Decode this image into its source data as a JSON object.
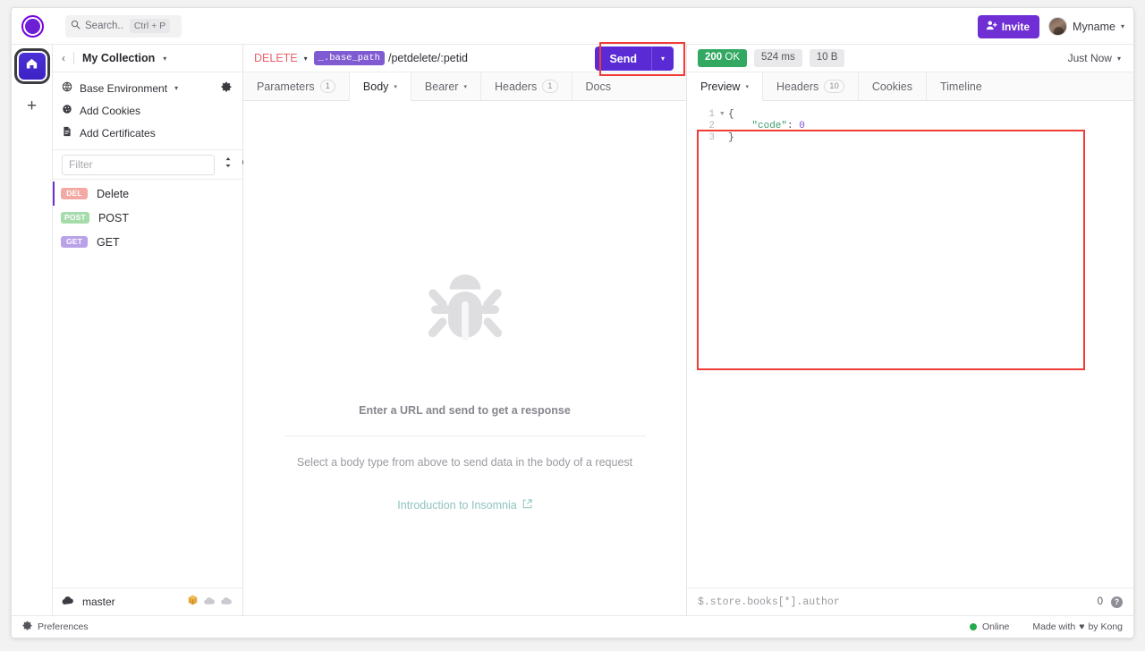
{
  "app": {
    "logo_icon": "insomnia-logo-icon"
  },
  "topbar": {
    "search": {
      "icon": "search-icon",
      "placeholder": "Search..",
      "label": "Search..",
      "shortcut": "Ctrl + P"
    },
    "invite_label": "Invite",
    "invite_icon": "person-add-icon",
    "account_name": "Myname",
    "account_caret": "▾",
    "invite_color": "#6f2fd4"
  },
  "rail": {
    "home_icon": "home-icon",
    "add_icon": "plus-icon",
    "home_color": "#3d21c4"
  },
  "sidebar": {
    "back_icon": "chevron-left-icon",
    "collection_name": "My Collection",
    "collection_caret": "▾",
    "env_items": [
      {
        "icon": "globe-icon",
        "label": "Base Environment",
        "caret": "▾",
        "has_gear": true,
        "gear_icon": "gear-icon"
      },
      {
        "icon": "cookie-icon",
        "label": "Add Cookies",
        "caret": "",
        "has_gear": false
      },
      {
        "icon": "certificate-icon",
        "label": "Add Certificates",
        "caret": "",
        "has_gear": false
      }
    ],
    "filter": {
      "placeholder": "Filter",
      "value": "",
      "sort_icon": "sort-icon",
      "add_icon": "plus-circle-icon"
    },
    "requests": [
      {
        "method": "DEL",
        "method_class": "del",
        "name": "Delete",
        "active": true
      },
      {
        "method": "POST",
        "method_class": "post",
        "name": "POST",
        "active": false
      },
      {
        "method": "GET",
        "method_class": "get",
        "name": "GET",
        "active": false
      }
    ],
    "vcs": {
      "icon": "cloud-icon",
      "branch": "master",
      "icons": [
        "package-icon",
        "cloud-download-icon",
        "cloud-upload-icon"
      ]
    }
  },
  "request": {
    "method": "DELETE",
    "method_caret": "▾",
    "url_template_var": "_.base_path",
    "url_path": "/petdelete/:petid",
    "send_label": "Send",
    "send_caret": "▾",
    "send_color": "#5a2bd4",
    "tabs": [
      {
        "label": "Parameters",
        "count": "1",
        "caret": "",
        "active": false
      },
      {
        "label": "Body",
        "count": "",
        "caret": "▾",
        "active": true
      },
      {
        "label": "Bearer",
        "count": "",
        "caret": "▾",
        "active": false
      },
      {
        "label": "Headers",
        "count": "1",
        "caret": "",
        "active": false
      },
      {
        "label": "Docs",
        "count": "",
        "caret": "",
        "active": false
      }
    ],
    "empty": {
      "illustration_icon": "bug-icon",
      "title": "Enter a URL and send to get a response",
      "subtitle": "Select a body type from above to send data in the body of a request",
      "link_label": "Introduction to Insomnia",
      "link_icon": "external-link-icon"
    }
  },
  "response": {
    "status_code": "200",
    "status_text": "OK",
    "status_color": "#32a862",
    "time": "524 ms",
    "size": "10 B",
    "history_label": "Just Now",
    "history_caret": "▾",
    "tabs": [
      {
        "label": "Preview",
        "count": "",
        "caret": "▾",
        "active": true
      },
      {
        "label": "Headers",
        "count": "10",
        "caret": "",
        "active": false
      },
      {
        "label": "Cookies",
        "count": "",
        "caret": "",
        "active": false
      },
      {
        "label": "Timeline",
        "count": "",
        "caret": "",
        "active": false
      }
    ],
    "code": [
      {
        "num": "1",
        "fold": "▾",
        "indent": "",
        "tokens": [
          {
            "t": "{",
            "c": "ctok-brace"
          }
        ]
      },
      {
        "num": "2",
        "fold": "",
        "indent": "    ",
        "tokens": [
          {
            "t": "\"code\"",
            "c": "ctok-key"
          },
          {
            "t": ":",
            "c": "ctok-brace"
          },
          {
            "t": " ",
            "c": "ctok-brace"
          },
          {
            "t": "0",
            "c": "ctok-num"
          }
        ]
      },
      {
        "num": "3",
        "fold": "",
        "indent": "",
        "tokens": [
          {
            "t": "}",
            "c": "ctok-brace"
          }
        ]
      }
    ],
    "filter": {
      "placeholder": "$.store.books[*].author",
      "value": "",
      "count": "0",
      "help_icon": "help-icon"
    }
  },
  "annotations": {
    "highlight_color": "#f03b36",
    "boxes": [
      "send-button-highlight",
      "response-preview-highlight"
    ]
  },
  "statusbar": {
    "prefs_icon": "gear-icon",
    "prefs_label": "Preferences",
    "online_label": "Online",
    "online_color": "#24a94b",
    "credit_prefix": "Made with",
    "credit_heart": "♥",
    "credit_suffix": "by Kong"
  }
}
